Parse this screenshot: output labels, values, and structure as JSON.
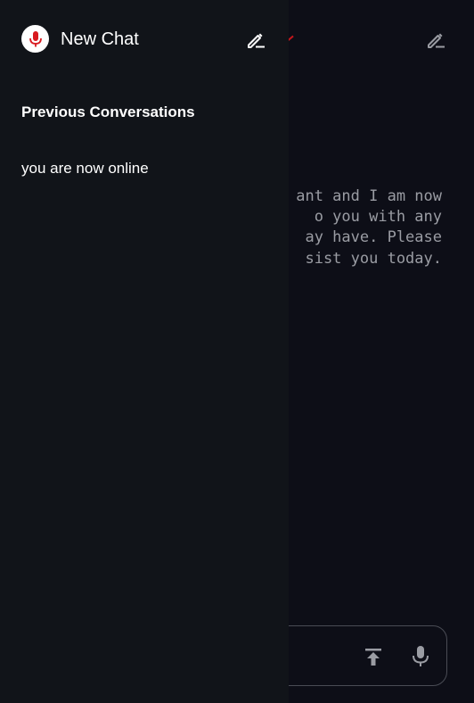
{
  "drawer": {
    "title": "New Chat",
    "section_title": "Previous Conversations",
    "conversations": [
      {
        "label": "you are now online"
      }
    ]
  },
  "main": {
    "message_lines": [
      "ant and I am now",
      "o you with any",
      "ay have. Please",
      "sist you today."
    ]
  },
  "icons": {
    "logo": "microphone-icon",
    "drawer_new_chat": "edit-icon",
    "main_new_chat": "edit-icon",
    "upload": "upload-icon",
    "mic": "microphone-icon"
  },
  "colors": {
    "accent": "#d91a1f",
    "drawer_bg": "#111419",
    "main_bg": "#0d0e17"
  }
}
